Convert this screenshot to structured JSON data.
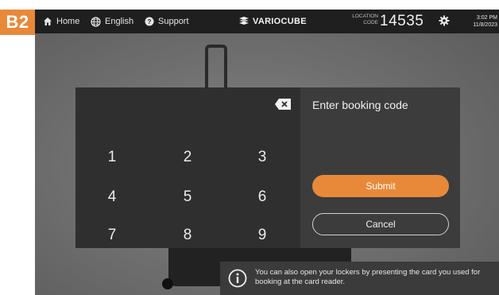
{
  "badge": "B2",
  "topbar": {
    "home_label": "Home",
    "language_label": "English",
    "support_label": "Support",
    "brand": "VARIOCUBE",
    "location_label_1": "LOCATION",
    "location_label_2": "CODE",
    "location_code": "14535",
    "time": "3:02 PM",
    "date": "11/8/2023"
  },
  "keypad": {
    "keys": [
      "1",
      "2",
      "3",
      "4",
      "5",
      "6",
      "7",
      "8",
      "9"
    ]
  },
  "panel": {
    "title": "Enter booking code",
    "submit_label": "Submit",
    "cancel_label": "Cancel"
  },
  "info": {
    "text": "You can also open your lockers by presenting the card you used for booking at the card reader."
  },
  "colors": {
    "accent": "#e8893a",
    "topbar": "#1f1f1f",
    "keypad": "#2f2f2f",
    "panel": "#3c3c3c"
  },
  "icons": [
    "home-icon",
    "globe-icon",
    "help-icon",
    "variocube-logo-icon",
    "gear-icon",
    "backspace-icon",
    "info-icon"
  ]
}
